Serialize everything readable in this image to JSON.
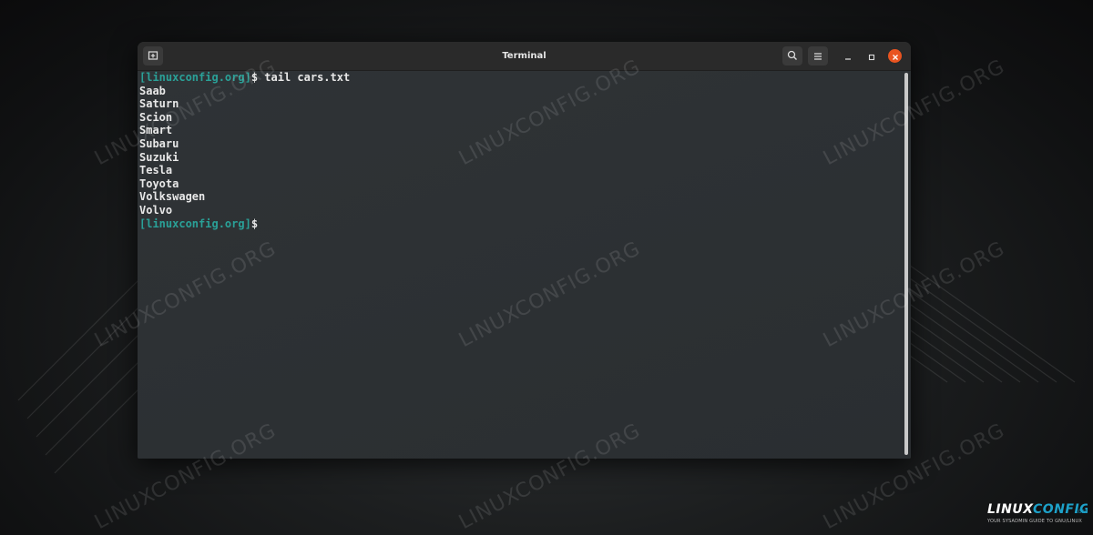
{
  "window": {
    "title": "Terminal"
  },
  "terminal": {
    "prompt": "[linuxconfig.org]",
    "command_line": "$ tail cars.txt",
    "output": [
      "Saab",
      "Saturn",
      "Scion",
      "Smart",
      "Subaru",
      "Suzuki",
      "Tesla",
      "Toyota",
      "Volkswagen",
      "Volvo"
    ],
    "final_prompt": "[linuxconfig.org]",
    "final_suffix": "$"
  },
  "watermark": {
    "text": "LINUXCONFIG.ORG"
  },
  "brand": {
    "name": "LINUXCONFIG",
    "tagline": "YOUR SYSADMIN GUIDE TO GNU/LINUX"
  },
  "icons": {
    "new_tab": "new-tab-icon",
    "search": "search-icon",
    "menu": "hamburger-menu-icon",
    "minimize": "minimize-icon",
    "maximize": "maximize-icon",
    "close": "close-icon"
  },
  "colors": {
    "prompt": "#2aa198",
    "close_button": "#e95420",
    "terminal_bg": "#2b2e31"
  }
}
